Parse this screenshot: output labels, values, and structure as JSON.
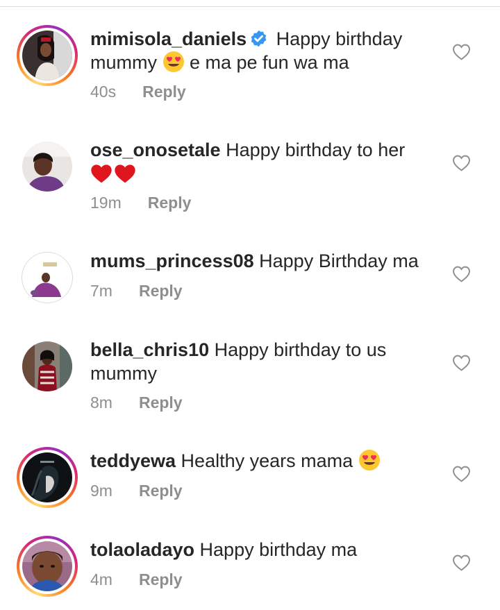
{
  "comments": [
    {
      "username": "mimisola_daniels",
      "verified": true,
      "text_before": " Happy birthday mummy ",
      "emoji": "heart-eyes",
      "text_after": " e ma pe fun wa ma",
      "time": "40s",
      "reply": "Reply"
    },
    {
      "username": "ose_onosetale",
      "text_before": " Happy birthday to her",
      "emoji": "two-red-hearts",
      "time": "19m",
      "reply": "Reply"
    },
    {
      "username": "mums_princess08",
      "text_before": " Happy Birthday ma",
      "time": "7m",
      "reply": "Reply"
    },
    {
      "username": "bella_chris10",
      "text_before": " Happy birthday to us mummy",
      "time": "8m",
      "reply": "Reply"
    },
    {
      "username": "teddyewa",
      "text_before": " Healthy years mama ",
      "emoji": "heart-eyes",
      "time": "9m",
      "reply": "Reply"
    },
    {
      "username": "tolaoladayo",
      "text_before": " Happy birthday ma",
      "time": "4m",
      "reply": "Reply"
    }
  ],
  "colors": {
    "text": "#262626",
    "meta": "#8e8e8e",
    "verified": "#3897f0",
    "divider": "#dbdbdb"
  }
}
